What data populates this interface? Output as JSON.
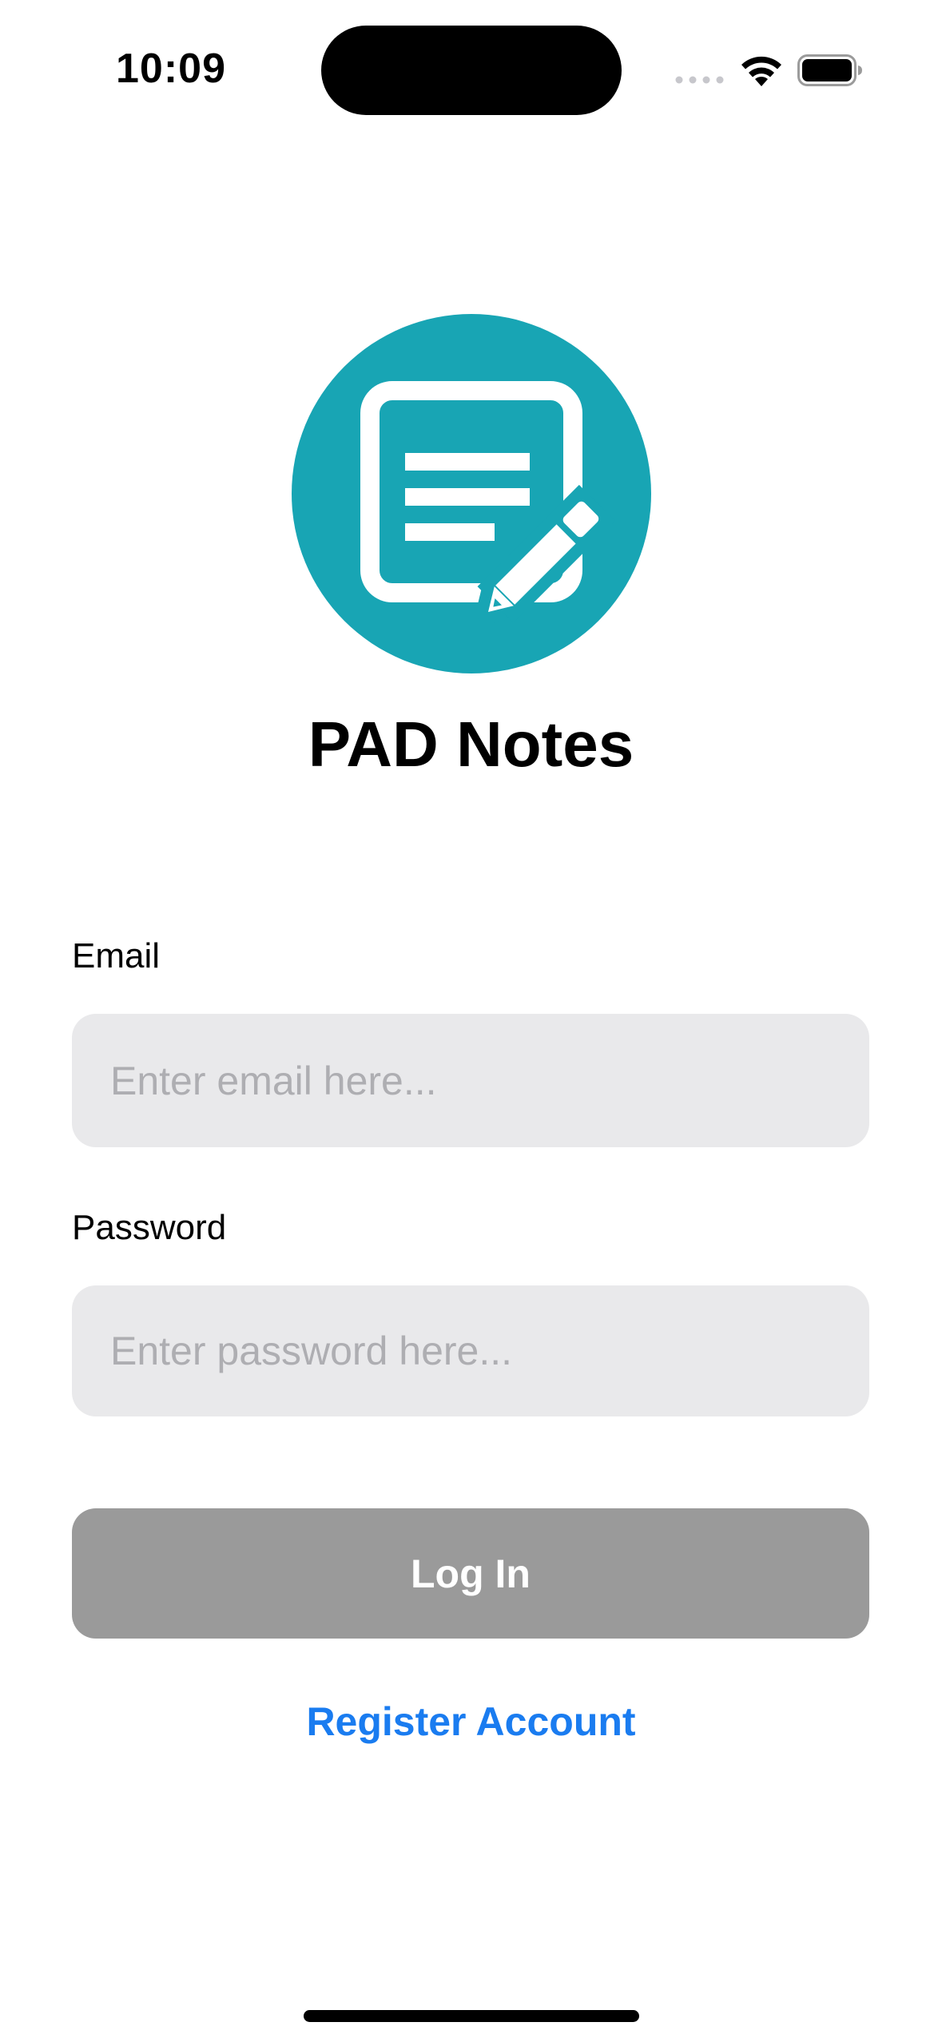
{
  "status_bar": {
    "time": "10:09",
    "icons": [
      "cellular-signal-icon",
      "wifi-icon",
      "battery-icon"
    ]
  },
  "app": {
    "title": "PAD Notes",
    "logo_icon": "note-with-pencil-icon",
    "logo_color": "#18a5b4"
  },
  "form": {
    "email_label": "Email",
    "email_placeholder": "Enter email here...",
    "email_value": "",
    "password_label": "Password",
    "password_placeholder": "Enter password here...",
    "password_value": "",
    "login_label": "Log In",
    "register_label": "Register Account"
  },
  "colors": {
    "input_bg": "#e9e9eb",
    "button_disabled": "#9a9a9a",
    "link": "#1a7cf0"
  }
}
